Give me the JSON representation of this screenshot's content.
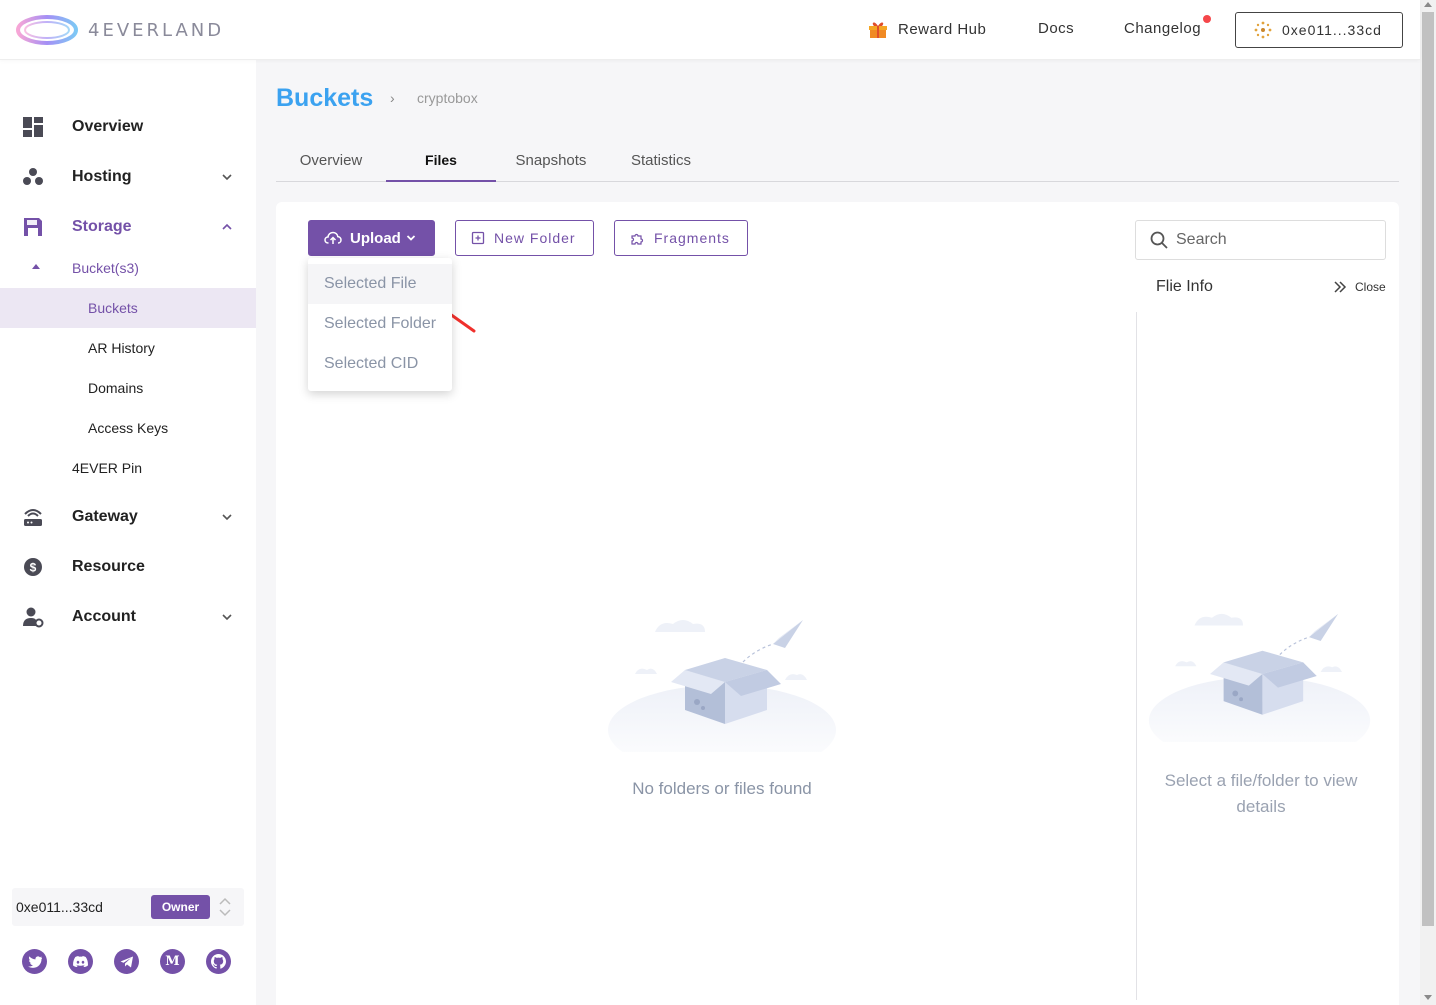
{
  "header": {
    "logo_text": "4EVERLAND",
    "reward_hub": "Reward Hub",
    "docs": "Docs",
    "changelog": "Changelog",
    "wallet": "0xe011...33cd"
  },
  "sidebar": {
    "items": [
      {
        "label": "Overview",
        "icon": "overview-icon"
      },
      {
        "label": "Hosting",
        "icon": "hosting-icon"
      },
      {
        "label": "Storage",
        "icon": "storage-icon"
      },
      {
        "label": "Gateway",
        "icon": "gateway-icon"
      },
      {
        "label": "Resource",
        "icon": "resource-icon"
      },
      {
        "label": "Account",
        "icon": "account-icon"
      }
    ],
    "storage_sub": {
      "bucket_s3": "Bucket(s3)",
      "buckets": "Buckets",
      "ar_history": "AR History",
      "domains": "Domains",
      "access_keys": "Access Keys",
      "pin": "4EVER Pin"
    },
    "account_box": {
      "address": "0xe011...33cd",
      "role": "Owner"
    },
    "socials": [
      "twitter-icon",
      "discord-icon",
      "telegram-icon",
      "medium-icon",
      "github-icon"
    ]
  },
  "page": {
    "title": "Buckets",
    "breadcrumb": "cryptobox",
    "tabs": [
      "Overview",
      "Files",
      "Snapshots",
      "Statistics"
    ],
    "active_tab": "Files"
  },
  "toolbar": {
    "upload": "Upload",
    "new_folder": "New Folder",
    "fragments": "Fragments",
    "search_placeholder": "Search"
  },
  "upload_menu": [
    "Selected File",
    "Selected Folder",
    "Selected CID"
  ],
  "files": {
    "empty": "No folders or files found"
  },
  "file_info": {
    "title": "Flie Info",
    "close": "Close",
    "empty": "Select a file/folder to view details"
  },
  "colors": {
    "accent": "#7451a8",
    "title_blue": "#3ba2f0",
    "notification_dot": "#f5474a"
  }
}
